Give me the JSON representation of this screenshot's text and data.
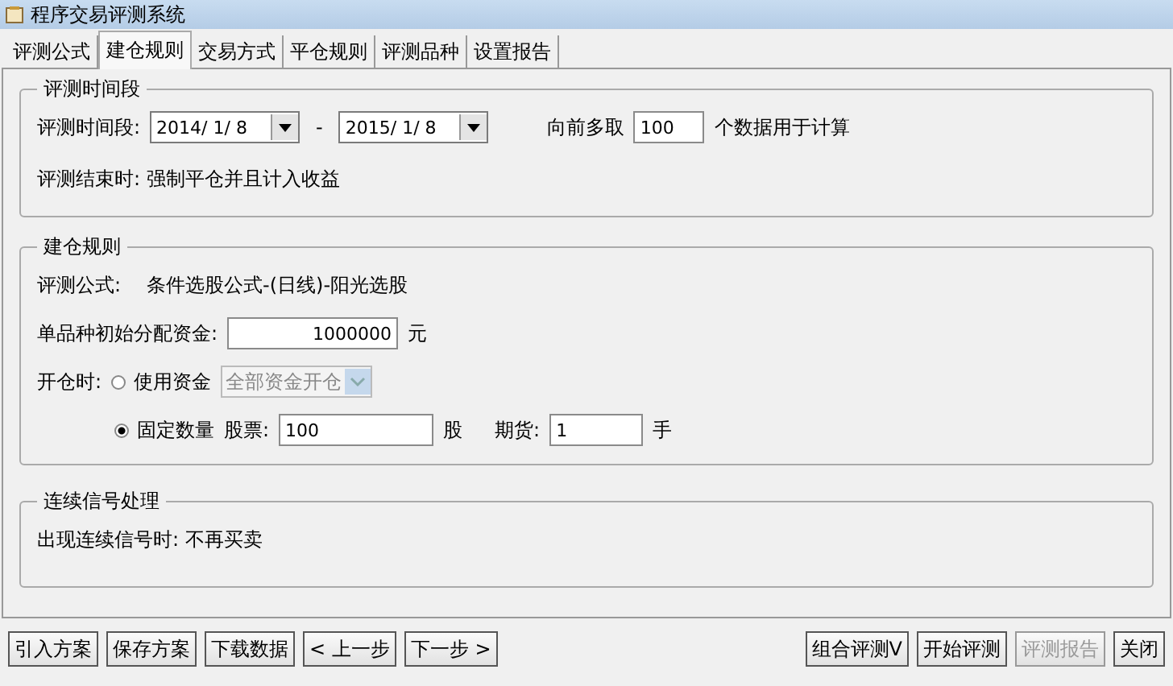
{
  "window": {
    "title": "程序交易评测系统"
  },
  "tabs": [
    {
      "label": "评测公式",
      "selected": false
    },
    {
      "label": "建仓规则",
      "selected": true
    },
    {
      "label": "交易方式",
      "selected": false
    },
    {
      "label": "平仓规则",
      "selected": false
    },
    {
      "label": "评测品种",
      "selected": false
    },
    {
      "label": "设置报告",
      "selected": false
    }
  ],
  "period_group": {
    "title": "评测时间段",
    "label": "评测时间段:",
    "start_date": "2014/ 1/ 8",
    "separator": "-",
    "end_date": "2015/ 1/ 8",
    "prefetch_label": "向前多取",
    "prefetch_value": "100",
    "prefetch_suffix": "个数据用于计算",
    "end_note": "评测结束时: 强制平仓并且计入收益"
  },
  "open_group": {
    "title": "建仓规则",
    "formula_label": "评测公式:",
    "formula_value": "条件选股公式-(日线)-阳光选股",
    "capital_label": "单品种初始分配资金:",
    "capital_value": "1000000",
    "capital_unit": "元",
    "open_label": "开仓时:",
    "options": [
      {
        "label": "使用资金",
        "selected": false
      },
      {
        "label": "固定数量",
        "selected": true
      }
    ],
    "capital_mode": {
      "value": "全部资金开仓",
      "disabled": true
    },
    "stock_label": "股票:",
    "stock_value": "100",
    "stock_unit": "股",
    "futures_label": "期货:",
    "futures_value": "1",
    "futures_unit": "手"
  },
  "signal_group": {
    "title": "连续信号处理",
    "text": "出现连续信号时: 不再买卖"
  },
  "buttons_left": [
    {
      "label": "引入方案",
      "disabled": false
    },
    {
      "label": "保存方案",
      "disabled": false
    },
    {
      "label": "下载数据",
      "disabled": false
    },
    {
      "label": "< 上一步",
      "disabled": false
    },
    {
      "label": "下一步 >",
      "disabled": false
    }
  ],
  "buttons_right": [
    {
      "label": "组合评测V",
      "disabled": false
    },
    {
      "label": "开始评测",
      "disabled": false
    },
    {
      "label": "评测报告",
      "disabled": true
    },
    {
      "label": "关闭",
      "disabled": false
    }
  ]
}
